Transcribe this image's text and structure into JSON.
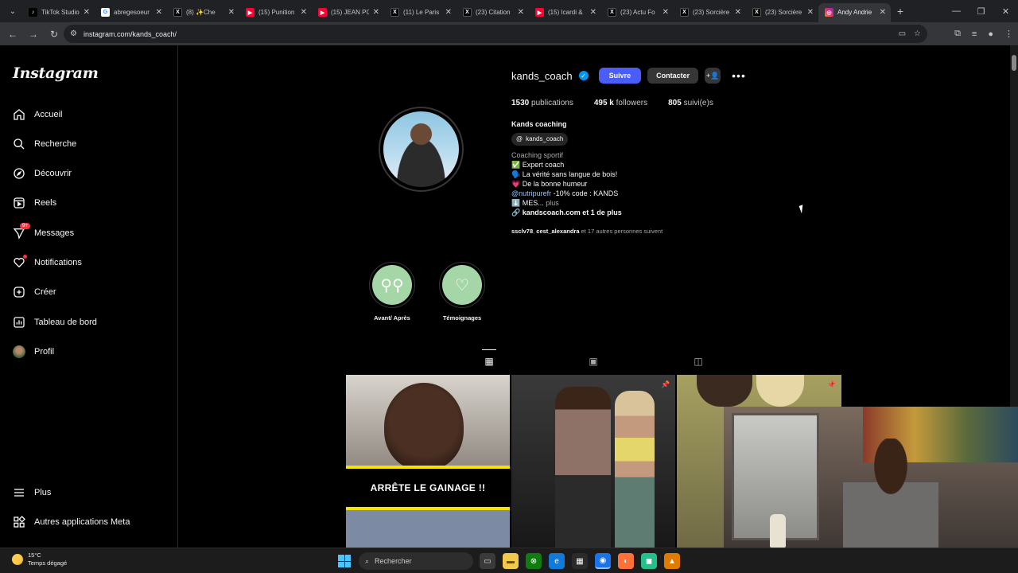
{
  "browser": {
    "tabs": [
      {
        "label": "TikTok Studio",
        "favicon_color": "#000000",
        "icon": "tiktok-icon"
      },
      {
        "label": "abregesoeur",
        "favicon_color": "#4285f4",
        "icon": "google-icon"
      },
      {
        "label": "(8) ✨Che",
        "favicon_color": "#000000",
        "icon": "x-icon"
      },
      {
        "label": "(15) Punition",
        "favicon_color": "#ff0033",
        "icon": "youtube-icon"
      },
      {
        "label": "(15) JEAN PC",
        "favicon_color": "#ff0033",
        "icon": "youtube-icon"
      },
      {
        "label": "(11) Le Paris",
        "favicon_color": "#000000",
        "icon": "x-icon"
      },
      {
        "label": "(23) Citation",
        "favicon_color": "#000000",
        "icon": "x-icon"
      },
      {
        "label": "(15) Icardi &",
        "favicon_color": "#ff0033",
        "icon": "youtube-icon"
      },
      {
        "label": "(23) Actu Fo",
        "favicon_color": "#000000",
        "icon": "x-icon"
      },
      {
        "label": "(23) Sorcière",
        "favicon_color": "#000000",
        "icon": "x-icon"
      },
      {
        "label": "(23) Sorcière",
        "favicon_color": "#000000",
        "icon": "x-icon"
      },
      {
        "label": "Andy Andrie",
        "favicon_color": "#e1306c",
        "icon": "instagram-icon",
        "active": true
      }
    ],
    "url": "instagram.com/kands_coach/"
  },
  "sidebar": {
    "logo": "Instagram",
    "items": [
      {
        "label": "Accueil",
        "icon": "home-icon"
      },
      {
        "label": "Recherche",
        "icon": "search-icon"
      },
      {
        "label": "Découvrir",
        "icon": "compass-icon"
      },
      {
        "label": "Reels",
        "icon": "reels-icon"
      },
      {
        "label": "Messages",
        "icon": "messenger-icon",
        "badge": "9+"
      },
      {
        "label": "Notifications",
        "icon": "heart-icon"
      },
      {
        "label": "Créer",
        "icon": "plus-square-icon"
      },
      {
        "label": "Tableau de bord",
        "icon": "dashboard-icon"
      },
      {
        "label": "Profil",
        "icon": "avatar"
      }
    ],
    "bottom": [
      {
        "label": "Plus",
        "icon": "menu-icon"
      },
      {
        "label": "Autres applications Meta",
        "icon": "meta-apps-icon"
      }
    ]
  },
  "profile": {
    "username": "kands_coach",
    "follow_label": "Suivre",
    "contact_label": "Contacter",
    "stats": {
      "posts_count": "1530",
      "posts_label": "publications",
      "followers_count": "495 k",
      "followers_label": "followers",
      "following_count": "805",
      "following_label": "suivi(e)s"
    },
    "display_name": "Kands coaching",
    "threads_handle": "kands_coach",
    "category": "Coaching sportif",
    "bio_lines": [
      "✅ Expert coach",
      "🗣️ La vérité sans langue de bois!",
      "💗 De la bonne humeur"
    ],
    "mention": "@nutripurefr",
    "mention_rest": " -10% code : KANDS",
    "mes_line": "⬇️ MES...",
    "more_label": " plus",
    "link": "kandscoach.com et 1 de plus",
    "followed_by_1": "ssclv78",
    "followed_by_2": "cest_alexandra",
    "followed_by_rest": " et 17 autres personnes suivent"
  },
  "highlights": [
    {
      "label": "Avant/ Après",
      "icon": "before-after-icon"
    },
    {
      "label": "Témoignages",
      "icon": "chat-heart-icon"
    }
  ],
  "posts": [
    {
      "overlay_text": "ARRÊTE LE GAINAGE !!"
    }
  ],
  "taskbar": {
    "temperature": "15°C",
    "weather": "Temps dégagé",
    "search_placeholder": "Rechercher"
  },
  "colors": {
    "follow_button": "#4a5df9",
    "verified": "#0095f6",
    "badge": "#ff3040",
    "highlight_bg": "#a5d6a7",
    "banner_yellow": "#f5e400"
  }
}
